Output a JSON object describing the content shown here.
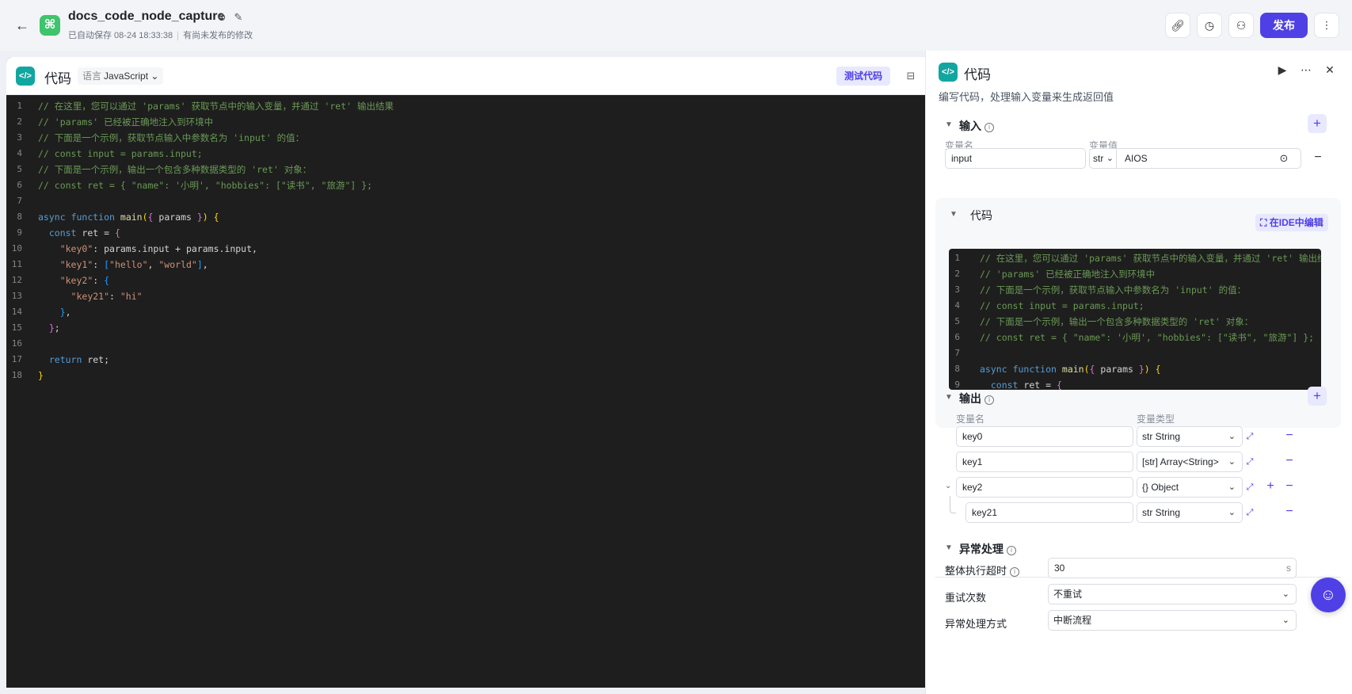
{
  "header": {
    "title": "docs_code_node_capture",
    "autosave": "已自动保存 08-24 18:33:38",
    "unpublished": "有尚未发布的修改",
    "publish_label": "发布"
  },
  "editor": {
    "title": "代码",
    "lang_prefix": "语言",
    "lang_value": "JavaScript",
    "test_label": "测试代码",
    "lines": [
      {
        "n": "1",
        "html": "<span class='cm'>// 在这里，您可以通过 'params' 获取节点中的输入变量，并通过 'ret' 输出结果</span>"
      },
      {
        "n": "2",
        "html": "<span class='cm'>// 'params' 已经被正确地注入到环境中</span>"
      },
      {
        "n": "3",
        "html": "<span class='cm'>// 下面是一个示例，获取节点输入中参数名为 'input' 的值：</span>"
      },
      {
        "n": "4",
        "html": "<span class='cm'>// const input = params.input;</span>"
      },
      {
        "n": "5",
        "html": "<span class='cm'>// 下面是一个示例，输出一个包含多种数据类型的 'ret' 对象：</span>"
      },
      {
        "n": "6",
        "html": "<span class='cm'>// const ret = { \"name\": '小明', \"hobbies\": [\"读书\", \"旅游\"] };</span>"
      },
      {
        "n": "7",
        "html": ""
      },
      {
        "n": "8",
        "html": "<span class='kw'>async</span> <span class='kw'>function</span> <span class='fn'>main</span><span class='br1'>(</span><span class='br2'>{</span> params <span class='br2'>}</span><span class='br1'>)</span> <span class='br1'>{</span>"
      },
      {
        "n": "9",
        "html": "  <span class='kw'>const</span> ret = <span class='br2'>{</span>"
      },
      {
        "n": "10",
        "html": "    <span class='st'>\"key0\"</span>: params.input + params.input,"
      },
      {
        "n": "11",
        "html": "    <span class='st'>\"key1\"</span>: <span class='br3'>[</span><span class='st'>\"hello\"</span>, <span class='st'>\"world\"</span><span class='br3'>]</span>,"
      },
      {
        "n": "12",
        "html": "    <span class='st'>\"key2\"</span>: <span class='br3'>{</span>"
      },
      {
        "n": "13",
        "html": "      <span class='st'>\"key21\"</span>: <span class='st'>\"hi\"</span>"
      },
      {
        "n": "14",
        "html": "    <span class='br3'>}</span>,"
      },
      {
        "n": "15",
        "html": "  <span class='br2'>}</span>;"
      },
      {
        "n": "16",
        "html": ""
      },
      {
        "n": "17",
        "html": "  <span class='kw'>return</span> ret;"
      },
      {
        "n": "18",
        "html": "<span class='br1'>}</span>"
      }
    ]
  },
  "panel": {
    "title": "代码",
    "description": "编写代码，处理输入变量来生成返回值",
    "input": {
      "title": "输入",
      "col_name": "变量名",
      "col_value": "变量值",
      "name": "input",
      "type": "str",
      "value": "AIOS"
    },
    "code": {
      "title": "代码",
      "ide_label": "在IDE中编辑",
      "visible_lines": 9
    },
    "output": {
      "title": "输出",
      "col_name": "变量名",
      "col_type": "变量类型",
      "rows": [
        {
          "name": "key0",
          "type": "str String"
        },
        {
          "name": "key1",
          "type": "[str] Array<String>"
        },
        {
          "name": "key2",
          "type": "{} Object"
        },
        {
          "name": "key21",
          "type": "str String"
        }
      ]
    },
    "exception": {
      "title": "异常处理",
      "timeout_label": "整体执行超时",
      "timeout_value": "30",
      "timeout_unit": "s",
      "retry_label": "重试次数",
      "retry_value": "不重试",
      "mode_label": "异常处理方式",
      "mode_value": "中断流程"
    }
  }
}
